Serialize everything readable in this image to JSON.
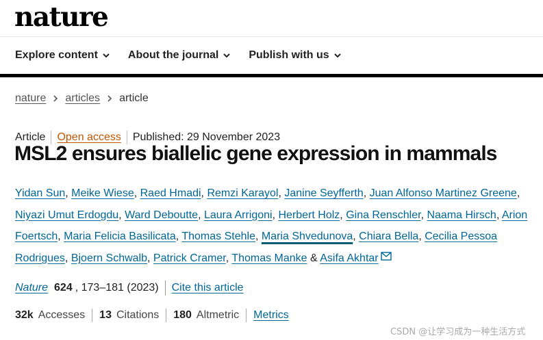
{
  "site": {
    "logo": "nature"
  },
  "nav": {
    "items": [
      "Explore content",
      "About the journal",
      "Publish with us"
    ]
  },
  "breadcrumb": {
    "items": [
      "nature",
      "articles",
      "article"
    ]
  },
  "article": {
    "type": "Article",
    "access": "Open access",
    "published": "Published: 29 November 2023",
    "title": "MSL2 ensures biallelic gene expression in mammals",
    "authors": [
      "Yidan Sun",
      "Meike Wiese",
      "Raed Hmadi",
      "Remzi Karayol",
      "Janine Seyfferth",
      "Juan Alfonso Martinez Greene",
      "Niyazi Umut Erdogdu",
      "Ward Deboutte",
      "Laura Arrigoni",
      "Herbert Holz",
      "Gina Renschler",
      "Naama Hirsch",
      "Arion Foertsch",
      "Maria Felicia Basilicata",
      "Thomas Stehle",
      "Maria Shvedunova",
      "Chiara Bella",
      "Cecilia Pessoa Rodrigues",
      "Bjoern Schwalb",
      "Patrick Cramer",
      "Thomas Manke",
      "Asifa Akhtar"
    ],
    "author_sep": ", ",
    "author_and": " & "
  },
  "citation": {
    "journal": "Nature",
    "volume": "624",
    "pages": ", 173–181 (2023)",
    "cite_label": "Cite this article"
  },
  "metrics": {
    "accesses_value": "32k",
    "accesses_label": "Accesses",
    "citations_value": "13",
    "citations_label": "Citations",
    "altmetric_value": "180",
    "altmetric_label": "Altmetric",
    "link_label": "Metrics"
  },
  "watermark": "CSDN @让学习成为一种生活方式"
}
